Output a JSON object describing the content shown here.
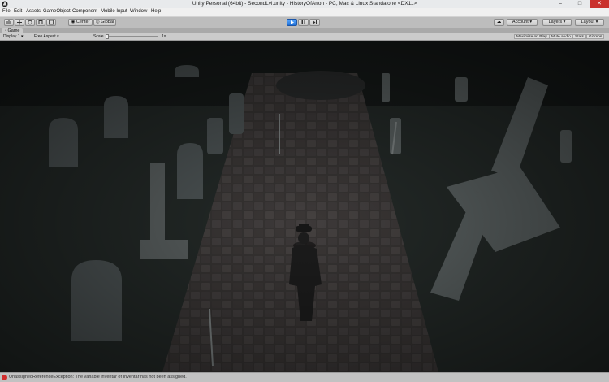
{
  "window": {
    "title": "Unity Personal (64bit) - SecondLvl.unity - HistoryOfAnon - PC, Mac & Linux Standalone <DX11>",
    "minimize": "–",
    "maximize": "□",
    "close": "✕"
  },
  "menu": [
    "File",
    "Edit",
    "Assets",
    "GameObject",
    "Component",
    "Mobile Input",
    "Window",
    "Help"
  ],
  "toolbar": {
    "center_label": "Center",
    "global_label": "Global",
    "account_label": "Account",
    "layers_label": "Layers",
    "layout_label": "Layout"
  },
  "game_tab": {
    "label": "Game"
  },
  "game_bar": {
    "display": "Display 1",
    "aspect": "Free Aspect",
    "scale_label": "Scale",
    "scale_value": "1x",
    "maximize": "Maximize on Play",
    "mute": "Mute audio",
    "stats": "Stats",
    "gizmos": "Gizmos"
  },
  "status": {
    "message": "UnassignedReferenceException: The variable inventar of Inventar has not been assigned."
  },
  "colors": {
    "accent_play": "#2a7de1",
    "error": "#d12d2d"
  }
}
